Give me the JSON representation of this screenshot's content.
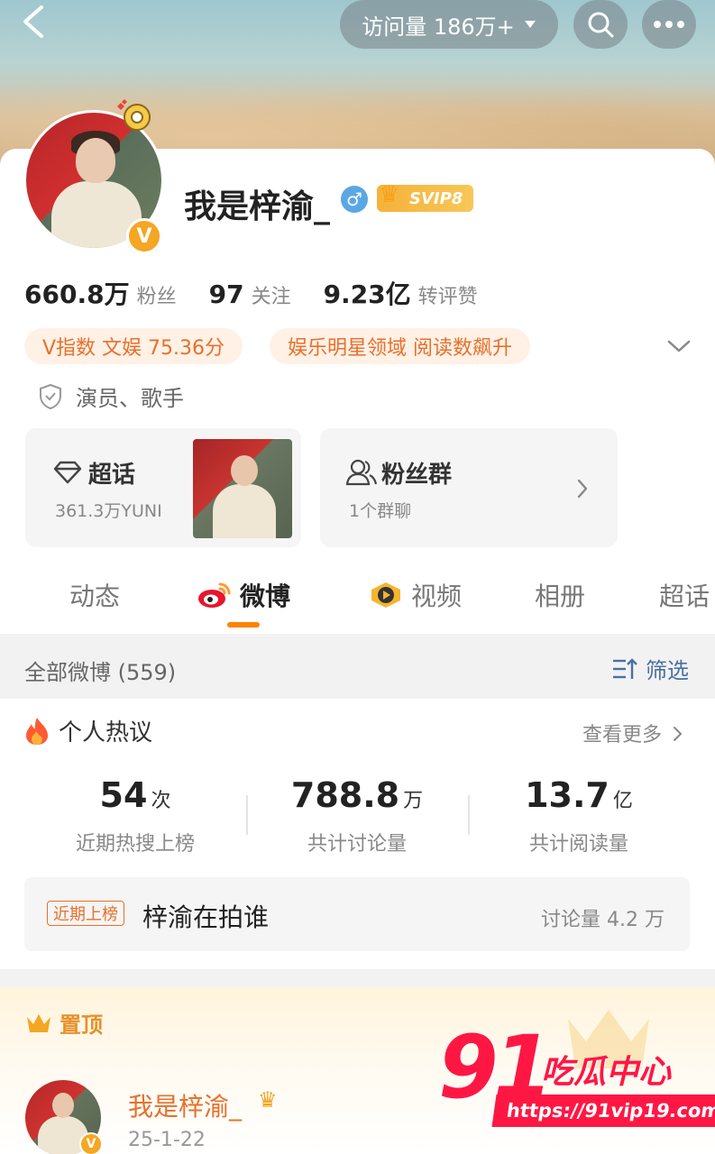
{
  "header": {
    "visits_label": "访问量 186万+"
  },
  "profile": {
    "name": "我是梓渝_",
    "svip_label": "SVIP8",
    "v_badge": "V",
    "stats": [
      {
        "value": "660.8万",
        "label": "粉丝"
      },
      {
        "value": "97",
        "label": "关注"
      },
      {
        "value": "9.23亿",
        "label": "转评赞"
      }
    ],
    "tags": [
      "V指数 文娱 75.36分",
      "娱乐明星领域 阅读数飙升"
    ],
    "identity": "演员、歌手"
  },
  "entries": {
    "super_topic": {
      "title": "超话",
      "sub": "361.3万YUNI"
    },
    "fan_group": {
      "title": "粉丝群",
      "sub": "1个群聊"
    }
  },
  "tabs": [
    "动态",
    "微博",
    "视频",
    "相册",
    "超话"
  ],
  "active_tab": "微博",
  "filter": {
    "count_label": "全部微博 (559)",
    "filter_label": "筛选"
  },
  "hot": {
    "title": "个人热议",
    "see_more": "查看更多",
    "metrics": [
      {
        "value": "54",
        "unit": "次",
        "label": "近期热搜上榜"
      },
      {
        "value": "788.8",
        "unit": "万",
        "label": "共计讨论量"
      },
      {
        "value": "13.7",
        "unit": "亿",
        "label": "共计阅读量"
      }
    ],
    "trend": {
      "badge": "近期上榜",
      "title": "梓渝在拍谁",
      "count": "讨论量 4.2 万"
    }
  },
  "pinned": {
    "label": "置顶",
    "post_name": "我是梓渝_",
    "post_date": "25-1-22"
  },
  "watermark": {
    "logo_num": "91",
    "logo_text": "吃瓜中心",
    "url": "https://91vip19.com"
  },
  "colors": {
    "accent": "#ff8200",
    "tag_bg": "#fff1e6",
    "tag_text": "#e8702a",
    "link_blue": "#4a6fa5",
    "watermark_red": "#ff1744"
  }
}
